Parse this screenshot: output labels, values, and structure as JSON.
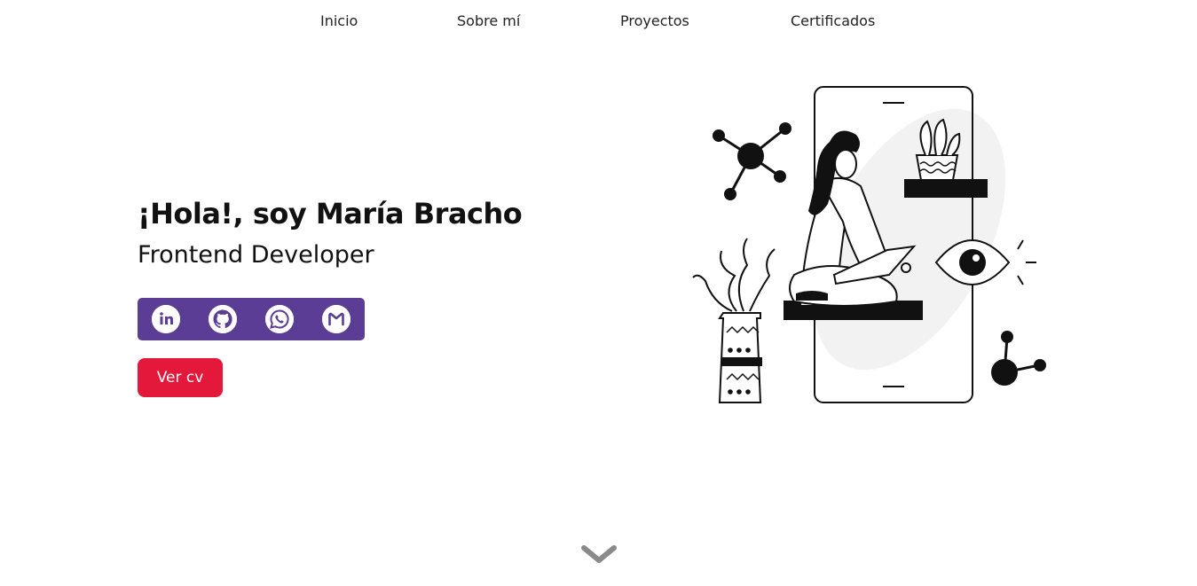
{
  "nav": {
    "items": [
      {
        "label": "Inicio"
      },
      {
        "label": "Sobre mí"
      },
      {
        "label": "Proyectos"
      },
      {
        "label": "Certificados"
      }
    ]
  },
  "hero": {
    "greeting": "¡Hola!, soy María Bracho",
    "role": "Frontend Developer",
    "cv_button": "Ver cv"
  },
  "social": {
    "bar_color": "#5b3d96",
    "items": [
      {
        "icon": "linkedin-icon"
      },
      {
        "icon": "github-icon"
      },
      {
        "icon": "whatsapp-icon"
      },
      {
        "icon": "gmail-icon"
      }
    ]
  },
  "colors": {
    "accent": "#e3183b",
    "social_bar": "#5b3d96",
    "text": "#111111"
  },
  "illustration": {
    "icon": "developer-woman-laptop-illustration"
  },
  "scroll": {
    "icon": "chevron-down-icon"
  }
}
